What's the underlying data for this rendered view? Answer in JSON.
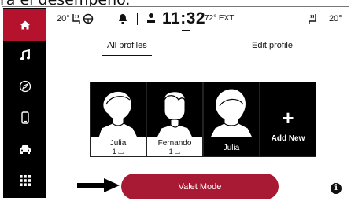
{
  "overlay_text": "ra el desempeño.",
  "status_bar": {
    "left_temp": "20°",
    "clock": "11:32",
    "exterior_temp": "72° EXT",
    "right_temp": "20°"
  },
  "tabs": [
    {
      "label": "All profiles",
      "active": true
    },
    {
      "label": "Edit profile",
      "active": false
    }
  ],
  "profiles": [
    {
      "name": "Julia",
      "seat": "1",
      "style": "card-light"
    },
    {
      "name": "Fernando",
      "seat": "1",
      "style": "card-light"
    },
    {
      "name": "Julia",
      "seat": "",
      "style": "card-dark"
    }
  ],
  "add_profile": {
    "label": "Add New"
  },
  "valet_button": {
    "label": "Valet Mode"
  },
  "info_icon": "i",
  "sidebar": [
    {
      "icon": "home-icon",
      "active": true
    },
    {
      "icon": "music-icon",
      "active": false
    },
    {
      "icon": "compass-icon",
      "active": false
    },
    {
      "icon": "phone-icon",
      "active": false
    },
    {
      "icon": "car-icon",
      "active": false
    },
    {
      "icon": "apps-grid-icon",
      "active": false
    }
  ],
  "colors": {
    "accent": "#a81a33",
    "sidebar": "#000000"
  }
}
